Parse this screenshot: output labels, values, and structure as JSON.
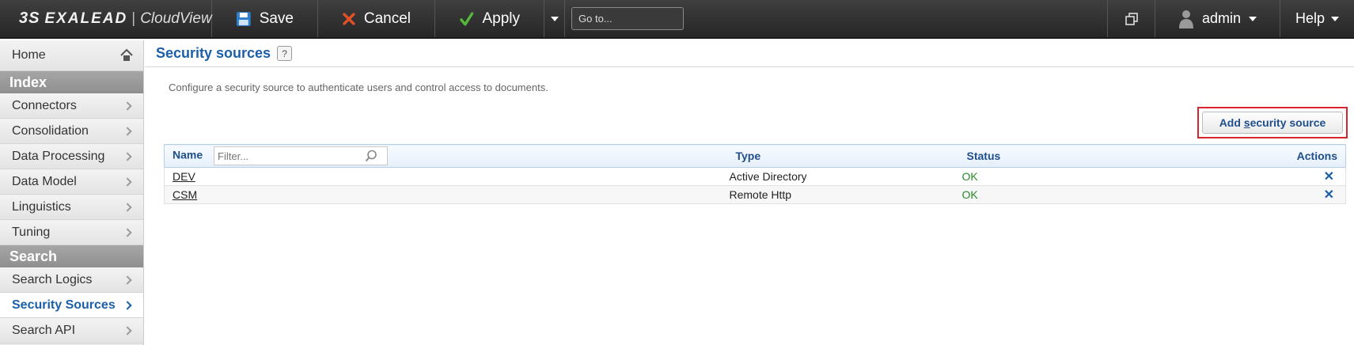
{
  "header": {
    "logo_ds": "3S",
    "logo_brand": "EXALEAD",
    "logo_sep": "|",
    "logo_product": "CloudView",
    "save_label": "Save",
    "cancel_label": "Cancel",
    "apply_label": "Apply",
    "goto_placeholder": "Go to...",
    "user_label": "admin",
    "help_label": "Help",
    "colors": {
      "bar": "#2f2f2f",
      "save_icon": "#2f7fd1",
      "cancel_icon": "#e2502a",
      "apply_icon": "#53b83a"
    }
  },
  "sidebar": {
    "home_label": "Home",
    "sections": [
      {
        "title": "Index",
        "items": [
          "Connectors",
          "Consolidation",
          "Data Processing",
          "Data Model",
          "Linguistics",
          "Tuning"
        ]
      },
      {
        "title": "Search",
        "items": [
          "Search Logics",
          "Security Sources",
          "Search API"
        ]
      }
    ],
    "active_item": "Security Sources"
  },
  "main": {
    "title": "Security sources",
    "help_badge": "?",
    "description": "Configure a security source to authenticate users and control access to documents.",
    "add_button": {
      "pre": "Add ",
      "underlined": "s",
      "post": "ecurity source"
    },
    "table": {
      "columns": {
        "name": "Name",
        "filter_placeholder": "Filter...",
        "type": "Type",
        "status": "Status",
        "actions": "Actions"
      },
      "rows": [
        {
          "name": "DEV",
          "type": "Active Directory",
          "status": "OK",
          "action": "✕"
        },
        {
          "name": "CSM",
          "type": "Remote Http",
          "status": "OK",
          "action": "✕"
        }
      ]
    },
    "colors": {
      "title": "#1a5fa8",
      "status_ok": "#2a8a2a",
      "highlight_border": "#d7262b"
    }
  }
}
